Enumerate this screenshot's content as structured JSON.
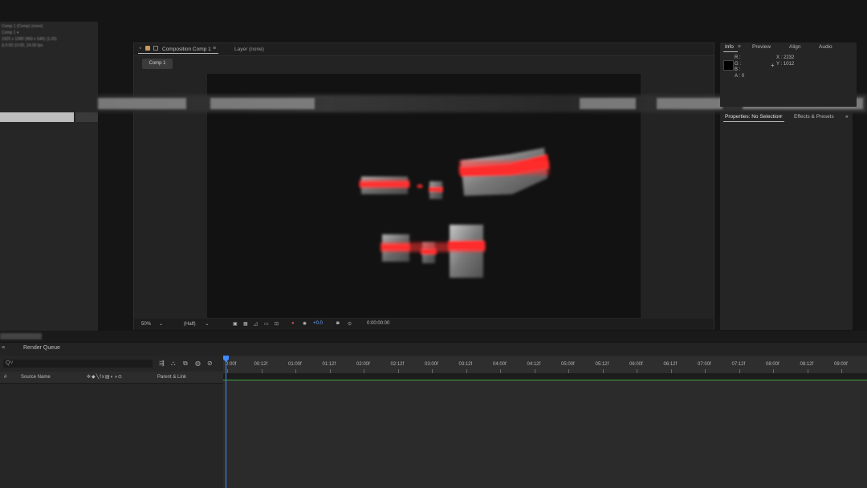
{
  "project": {
    "meta_lines": [
      "Comp 1 (Comp) (none)",
      "Comp 1 ▾",
      "1920 x 1080 (960 x 540) (1.00)",
      "Δ 0:00:10:00, 24.00 fps"
    ]
  },
  "composition": {
    "tab_title": "Composition Comp 1",
    "layer_tab": "Layer (none)",
    "breadcrumb": "Comp 1",
    "zoom": "50%",
    "resolution": "(Half)",
    "exposure": "+0.0",
    "timecode": "0:00:00:00"
  },
  "info": {
    "tabs": [
      "Info",
      "Preview",
      "Align",
      "Audio"
    ],
    "r_label": "R :",
    "g_label": "G :",
    "b_label": "B :",
    "a_label": "A :",
    "a_value": "0",
    "x_label": "X : 2232",
    "y_label": "Y : 1012"
  },
  "properties": {
    "tab1": "Properties: No Selection",
    "tab2": "Effects & Presets"
  },
  "render_queue": {
    "label": "Render Queue"
  },
  "timeline": {
    "search_placeholder": "Q˅",
    "col_num": "#",
    "col_source": "Source Name",
    "col_parent": "Parent & Link",
    "ruler_labels": [
      "0:00f",
      "00:12f",
      "01:00f",
      "01:12f",
      "02:00f",
      "02:12f",
      "03:00f",
      "03:12f",
      "04:00f",
      "04:12f",
      "05:00f",
      "05:12f",
      "06:00f",
      "06:12f",
      "07:00f",
      "07:12f",
      "08:00f",
      "08:12f",
      "09:00f"
    ]
  }
}
